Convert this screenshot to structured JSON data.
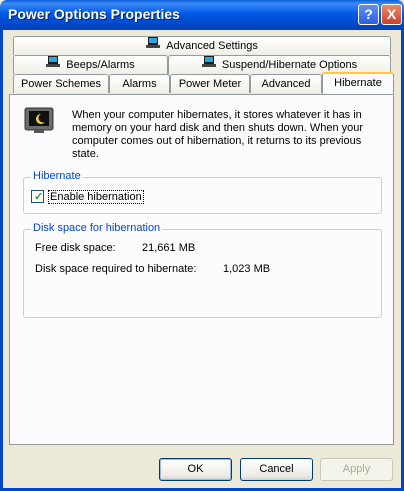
{
  "window": {
    "title": "Power Options Properties"
  },
  "title_buttons": {
    "help": "?",
    "close": "X"
  },
  "tabs": {
    "row1": [
      {
        "label": "Advanced Settings",
        "icon": "laptop-icon"
      }
    ],
    "row2": [
      {
        "label": "Beeps/Alarms",
        "icon": "laptop-icon"
      },
      {
        "label": "Suspend/Hibernate Options",
        "icon": "laptop-icon"
      }
    ],
    "row3": [
      {
        "label": "Power Schemes"
      },
      {
        "label": "Alarms"
      },
      {
        "label": "Power Meter"
      },
      {
        "label": "Advanced"
      },
      {
        "label": "Hibernate"
      }
    ],
    "active": "Hibernate"
  },
  "hibernate": {
    "description": "When your computer hibernates, it stores whatever it has in memory on your hard disk and then shuts down. When your computer comes out of hibernation, it returns to its previous state.",
    "group_title": "Hibernate",
    "checkbox_label": "Enable hibernation",
    "checked": true
  },
  "disk_space": {
    "group_title": "Disk space for hibernation",
    "free_label": "Free disk space:",
    "free_value": "21,661 MB",
    "required_label": "Disk space required to hibernate:",
    "required_value": "1,023 MB"
  },
  "buttons": {
    "ok": "OK",
    "cancel": "Cancel",
    "apply": "Apply"
  }
}
